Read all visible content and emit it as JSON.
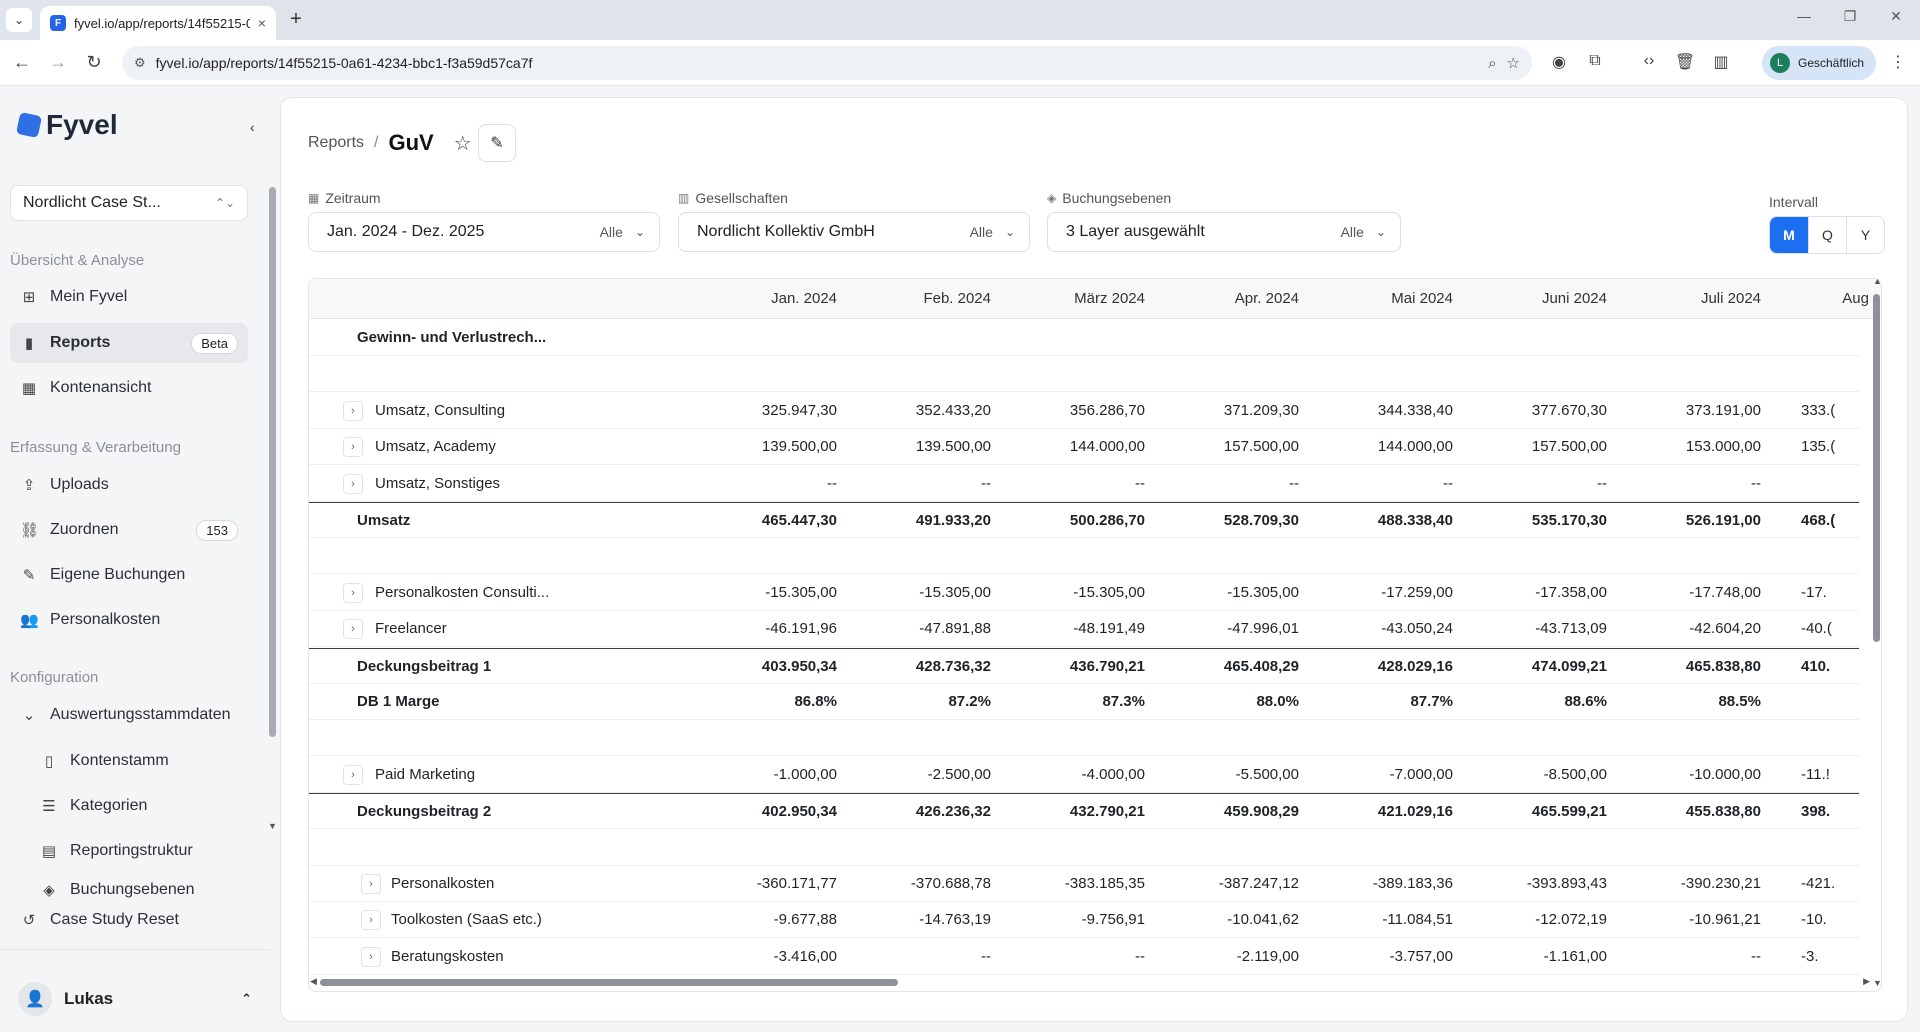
{
  "browser": {
    "tab_title": "fyvel.io/app/reports/14f55215-0",
    "tab_favicon": "F",
    "tab_close": "×",
    "new_tab": "+",
    "url": "fyvel.io/app/reports/14f55215-0a61-4234-bbc1-f3a59d57ca7f",
    "profile_initial": "L",
    "profile_label": "Geschäftlich"
  },
  "sidebar": {
    "logo": "Fyvel",
    "company": "Nordlicht Case St...",
    "sections": {
      "overview": "Übersicht & Analyse",
      "capture": "Erfassung & Verarbeitung",
      "config": "Konfiguration"
    },
    "items": {
      "mein_fyvel": "Mein Fyvel",
      "reports": "Reports",
      "reports_badge": "Beta",
      "kontenansicht": "Kontenansicht",
      "uploads": "Uploads",
      "zuordnen": "Zuordnen",
      "zuordnen_badge": "153",
      "eigene_buchungen": "Eigene Buchungen",
      "personalkosten": "Personalkosten",
      "auswertung": "Auswertungsstammdaten",
      "kontenstamm": "Kontenstamm",
      "kategorien": "Kategorien",
      "reportingstruktur": "Reportingstruktur",
      "buchungsebenen": "Buchungsebenen",
      "reset": "Case Study Reset"
    },
    "user": "Lukas"
  },
  "page": {
    "breadcrumb_parent": "Reports",
    "breadcrumb_sep": "/",
    "title": "GuV"
  },
  "filters": {
    "zeitraum_label": "Zeitraum",
    "zeitraum_value": "Jan. 2024 - Dez. 2025",
    "gesellschaften_label": "Gesellschaften",
    "gesellschaften_value": "Nordlicht Kollektiv GmbH",
    "buchungsebenen_label": "Buchungsebenen",
    "buchungsebenen_value": "3 Layer ausgewählt",
    "all_label": "Alle",
    "intervall_label": "Intervall",
    "intervals": [
      "M",
      "Q",
      "Y"
    ],
    "active_interval": "M"
  },
  "table": {
    "columns": [
      "Jan. 2024",
      "Feb. 2024",
      "März 2024",
      "Apr. 2024",
      "Mai 2024",
      "Juni 2024",
      "Juli 2024",
      "Aug"
    ],
    "rows": [
      {
        "label": "Gewinn- und Verlustrech...",
        "kind": "header",
        "values": []
      },
      {
        "label": "",
        "kind": "spacer",
        "values": []
      },
      {
        "label": "Umsatz, Consulting",
        "kind": "item",
        "values": [
          "325.947,30",
          "352.433,20",
          "356.286,70",
          "371.209,30",
          "344.338,40",
          "377.670,30",
          "373.191,00",
          "333.("
        ]
      },
      {
        "label": "Umsatz, Academy",
        "kind": "item",
        "values": [
          "139.500,00",
          "139.500,00",
          "144.000,00",
          "157.500,00",
          "144.000,00",
          "157.500,00",
          "153.000,00",
          "135.("
        ]
      },
      {
        "label": "Umsatz, Sonstiges",
        "kind": "item",
        "values": [
          "--",
          "--",
          "--",
          "--",
          "--",
          "--",
          "--",
          ""
        ]
      },
      {
        "label": "Umsatz",
        "kind": "total",
        "values": [
          "465.447,30",
          "491.933,20",
          "500.286,70",
          "528.709,30",
          "488.338,40",
          "535.170,30",
          "526.191,00",
          "468.("
        ]
      },
      {
        "label": "",
        "kind": "spacer",
        "values": []
      },
      {
        "label": "Personalkosten Consulti...",
        "kind": "item",
        "values": [
          "-15.305,00",
          "-15.305,00",
          "-15.305,00",
          "-15.305,00",
          "-17.259,00",
          "-17.358,00",
          "-17.748,00",
          "-17."
        ]
      },
      {
        "label": "Freelancer",
        "kind": "item",
        "values": [
          "-46.191,96",
          "-47.891,88",
          "-48.191,49",
          "-47.996,01",
          "-43.050,24",
          "-43.713,09",
          "-42.604,20",
          "-40.("
        ]
      },
      {
        "label": "Deckungsbeitrag 1",
        "kind": "total",
        "values": [
          "403.950,34",
          "428.736,32",
          "436.790,21",
          "465.408,29",
          "428.029,16",
          "474.099,21",
          "465.838,80",
          "410."
        ]
      },
      {
        "label": "DB 1 Marge",
        "kind": "header",
        "values": [
          "86.8%",
          "87.2%",
          "87.3%",
          "88.0%",
          "87.7%",
          "88.6%",
          "88.5%",
          ""
        ]
      },
      {
        "label": "",
        "kind": "spacer",
        "values": []
      },
      {
        "label": "Paid Marketing",
        "kind": "item",
        "values": [
          "-1.000,00",
          "-2.500,00",
          "-4.000,00",
          "-5.500,00",
          "-7.000,00",
          "-8.500,00",
          "-10.000,00",
          "-11.!"
        ]
      },
      {
        "label": "Deckungsbeitrag 2",
        "kind": "total",
        "values": [
          "402.950,34",
          "426.236,32",
          "432.790,21",
          "459.908,29",
          "421.029,16",
          "465.599,21",
          "455.838,80",
          "398."
        ]
      },
      {
        "label": "",
        "kind": "spacer",
        "values": []
      },
      {
        "label": "Personalkosten",
        "kind": "subitem",
        "values": [
          "-360.171,77",
          "-370.688,78",
          "-383.185,35",
          "-387.247,12",
          "-389.183,36",
          "-393.893,43",
          "-390.230,21",
          "-421."
        ]
      },
      {
        "label": "Toolkosten (SaaS etc.)",
        "kind": "subitem",
        "values": [
          "-9.677,88",
          "-14.763,19",
          "-9.756,91",
          "-10.041,62",
          "-11.084,51",
          "-12.072,19",
          "-10.961,21",
          "-10."
        ]
      },
      {
        "label": "Beratungskosten",
        "kind": "subitem",
        "values": [
          "-3.416,00",
          "--",
          "--",
          "-2.119,00",
          "-3.757,00",
          "-1.161,00",
          "--",
          "-3."
        ]
      }
    ]
  }
}
